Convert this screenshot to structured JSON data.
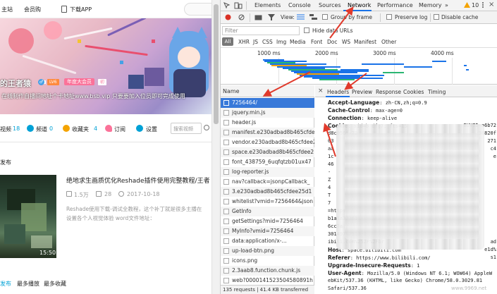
{
  "site": {
    "nav": {
      "home": "主站",
      "members": "会员购",
      "download": "下载APP"
    },
    "profile": {
      "username": "的王者猿",
      "level": "LV6",
      "vip": "年度大会员",
      "badge": "初",
      "signature": "在线制作自播间地址个卡地址www.bsb.vip 只要要加入位员即可完成使用"
    },
    "tabs": [
      {
        "label": "视频",
        "count": "18"
      },
      {
        "label": "频道",
        "count": "0"
      },
      {
        "label": "收藏夹",
        "count": "4"
      },
      {
        "label": "订阅",
        "count": ""
      },
      {
        "label": "设置",
        "count": ""
      }
    ],
    "search_placeholder": "搜索视频",
    "section_label": "最新发布",
    "video": {
      "title": "绝地求生画质优化Reshade插件使用完整教程/王者",
      "views": "1.5万",
      "comments": "28",
      "date": "2017-10-18",
      "desc1": "Reshade使用下载-调试全教程，这个补丁就是很多主播在",
      "desc2": "设置各个人视觉体验 word文件地址：",
      "duration": "15:50"
    },
    "bottom_tabs": [
      "最新发布",
      "最多播放",
      "最多收藏"
    ]
  },
  "devtools": {
    "tabs": [
      "Elements",
      "Console",
      "Sources",
      "Network",
      "Performance",
      "Memory"
    ],
    "active_tab": "Network",
    "warning_count": "10",
    "toolbar": {
      "view_label": "View:",
      "group_by_frame": "Group by frame",
      "preserve_log": "Preserve log",
      "disable_cache": "Disable cache"
    },
    "filter_placeholder": "Filter",
    "hide_data_urls": "Hide data URLs",
    "type_filters": [
      "All",
      "XHR",
      "JS",
      "CSS",
      "Img",
      "Media",
      "Font",
      "Doc",
      "WS",
      "Manifest",
      "Other"
    ],
    "timeline_labels": [
      "1000 ms",
      "2000 ms",
      "3000 ms",
      "4000 ms"
    ],
    "name_header": "Name",
    "requests": [
      "7256464/",
      "jquery.min.js",
      "header.js",
      "manifest.e230adbad8b465cfde",
      "vendor.e230adbad8b465cfdee2",
      "space.e230adbad8b465cfdee2",
      "font_438759_6uqfqtzb01ux47",
      "log-reporter.js",
      "nav?callback=jsonpCallback_",
      "3.e230adbad8b465cfdee25d1",
      "whitelist?vmid=7256464&json",
      "GetInfo",
      "getSettings?mid=7256464",
      "MyInfo?vmid=7256464",
      "data:application/x-...",
      "up-load-btn.png",
      "icons.png",
      "2.3aab8.function.chunk.js",
      "web?0000141523504580891h"
    ],
    "selected_request": 0,
    "status": "135 requests | 41.4 KB transferred",
    "detail_tabs": [
      "Headers",
      "Preview",
      "Response",
      "Cookies",
      "Timing"
    ],
    "active_detail_tab": "Headers",
    "headers": [
      {
        "name": "Accept-Language",
        "value": "zh-CN,zh;q=0.9"
      },
      {
        "name": "Cache-Control",
        "value": "max-age=0"
      },
      {
        "name": "Connection",
        "value": "keep-alive"
      },
      {
        "name": "Cookie",
        "value": "sid=b  dfg7; fts=15"
      },
      {
        "name": "",
        "value": "d8c056f-70"
      },
      {
        "name": "",
        "value": "03"
      },
      {
        "name": "",
        "value": "aa"
      },
      {
        "name": "",
        "value": "1c"
      },
      {
        "name": "",
        "value": "46"
      },
      {
        "name": "",
        "value": "-"
      },
      {
        "name": "",
        "value": "Z"
      },
      {
        "name": "",
        "value": "4"
      },
      {
        "name": "",
        "value": "T"
      },
      {
        "name": "",
        "value": "7"
      },
      {
        "name": "",
        "value": "=https"
      },
      {
        "name": "",
        "value": "b1a1a32261"
      },
      {
        "name": "",
        "value": "6cc7a"
      },
      {
        "name": "",
        "value": "301497%7910-1"
      },
      {
        "name": "",
        "value": "ibili.com%252F%2Fbr"
      },
      {
        "name": "Host",
        "value": "space.bilibili.com"
      },
      {
        "name": "Referer",
        "value": "https://www.bilibili.com/"
      },
      {
        "name": "Upgrade-Insecure-Requests",
        "value": "1"
      },
      {
        "name": "User-Agent",
        "value": "Mozilla/5.0 (Windows NT 6.1; WOW64) AppleW"
      },
      {
        "name": "",
        "value": "ebKit/537.36 (KHTML, like Gecko) Chrome/58.0.3029.81"
      },
      {
        "name": "",
        "value": "Safari/537.36"
      }
    ],
    "cookie_right_fragments": [
      "BUVID=a6b72",
      "38820f",
      "271",
      "c4",
      "e",
      "ad",
      "e1d%",
      "s1"
    ],
    "watermark": "www.9969.net"
  },
  "colors": {
    "bili_pink": "#fb7299",
    "bili_blue": "#00a1d6",
    "devtools_blue": "#1a73e8",
    "selected_row": "#3879d9",
    "annotation_arrow": "#e03a2c"
  }
}
